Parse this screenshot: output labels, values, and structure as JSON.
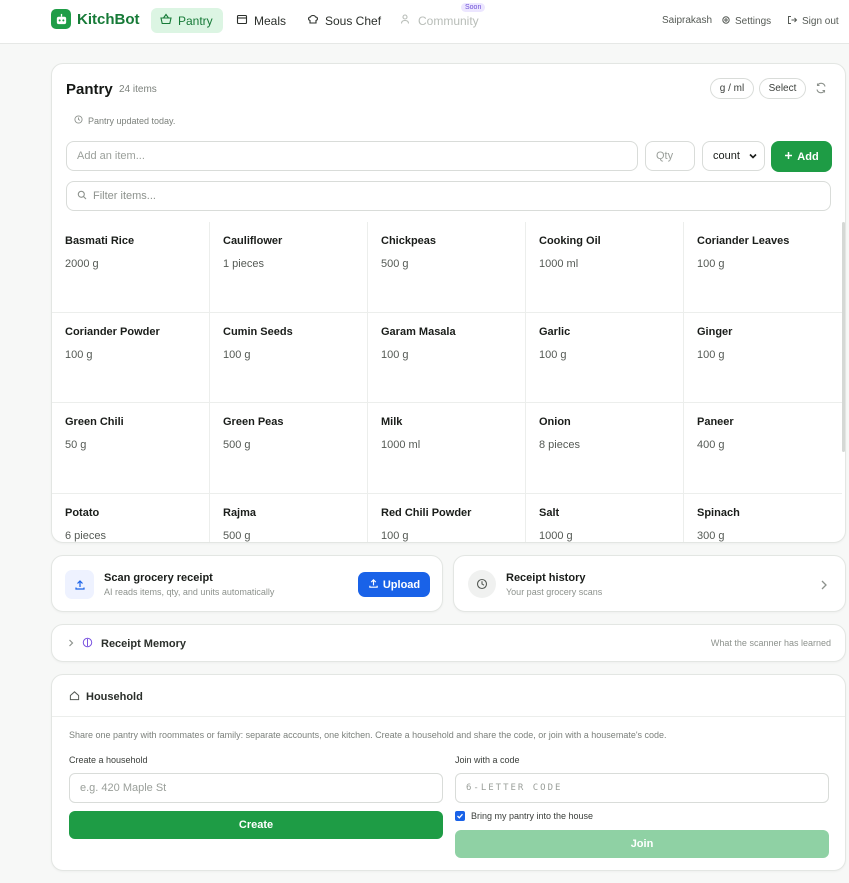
{
  "nav": {
    "brand": "KitchBot",
    "tabs": [
      {
        "label": "Pantry",
        "icon": "basket-icon",
        "active": true
      },
      {
        "label": "Meals",
        "icon": "calendar-icon"
      },
      {
        "label": "Sous Chef",
        "icon": "chef-hat-icon"
      },
      {
        "label": "Community",
        "icon": "users-icon",
        "badge": "Soon",
        "disabled": true
      }
    ],
    "user": "Saiprakash",
    "settings_label": "Settings",
    "signout_label": "Sign out"
  },
  "pantry": {
    "title": "Pantry",
    "count": "24 items",
    "unit_toggle": "g / ml",
    "select_label": "Select",
    "updated": "Pantry updated today.",
    "add_placeholder": "Add an item...",
    "qty_placeholder": "Qty",
    "unit_value": "count",
    "add_label": "Add",
    "filter_placeholder": "Filter items...",
    "items": [
      {
        "name": "Basmati Rice",
        "qty": "2000 g"
      },
      {
        "name": "Cauliflower",
        "qty": "1 pieces"
      },
      {
        "name": "Chickpeas",
        "qty": "500 g"
      },
      {
        "name": "Cooking Oil",
        "qty": "1000 ml"
      },
      {
        "name": "Coriander Leaves",
        "qty": "100 g"
      },
      {
        "name": "Coriander Powder",
        "qty": "100 g"
      },
      {
        "name": "Cumin Seeds",
        "qty": "100 g"
      },
      {
        "name": "Garam Masala",
        "qty": "100 g"
      },
      {
        "name": "Garlic",
        "qty": "100 g"
      },
      {
        "name": "Ginger",
        "qty": "100 g"
      },
      {
        "name": "Green Chili",
        "qty": "50 g"
      },
      {
        "name": "Green Peas",
        "qty": "500 g"
      },
      {
        "name": "Milk",
        "qty": "1000 ml"
      },
      {
        "name": "Onion",
        "qty": "8 pieces"
      },
      {
        "name": "Paneer",
        "qty": "400 g"
      },
      {
        "name": "Potato",
        "qty": "6 pieces"
      },
      {
        "name": "Rajma",
        "qty": "500 g"
      },
      {
        "name": "Red Chili Powder",
        "qty": "100 g"
      },
      {
        "name": "Salt",
        "qty": "1000 g"
      },
      {
        "name": "Spinach",
        "qty": "300 g"
      }
    ]
  },
  "scan": {
    "title": "Scan grocery receipt",
    "subtitle": "AI reads items, qty, and units automatically",
    "upload_label": "Upload"
  },
  "history": {
    "title": "Receipt history",
    "subtitle": "Your past grocery scans"
  },
  "memory": {
    "title": "Receipt Memory",
    "hint": "What the scanner has learned"
  },
  "household": {
    "title": "Household",
    "description": "Share one pantry with roommates or family: separate accounts, one kitchen. Create a household and share the code, or join with a housemate's code.",
    "create_label": "Create a household",
    "create_placeholder": "e.g. 420 Maple St",
    "create_button": "Create",
    "join_label": "Join with a code",
    "join_placeholder": "6-LETTER CODE",
    "bring_pantry": "Bring my pantry into the house",
    "join_button": "Join"
  },
  "colors": {
    "brand": "#1e9c45",
    "brand_light": "#dcf5e3",
    "accent_blue": "#1962e8",
    "join_disabled": "#8fd1a4"
  }
}
